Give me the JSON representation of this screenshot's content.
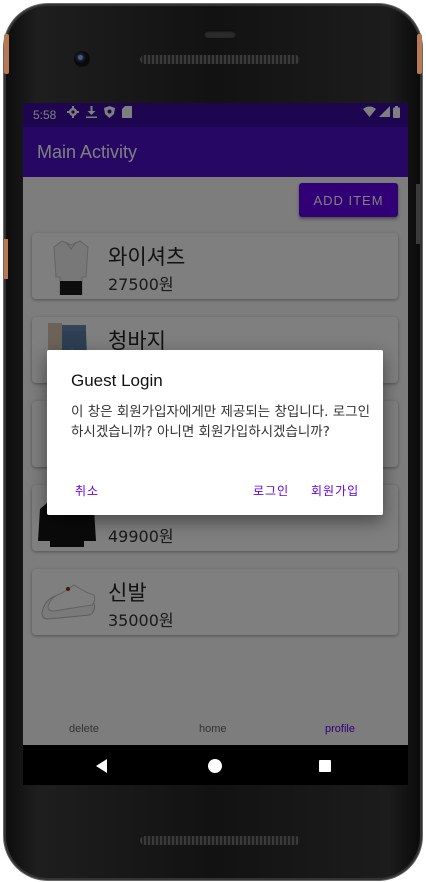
{
  "status_bar": {
    "time": "5:58",
    "left_icons": [
      "gear-icon",
      "download-icon",
      "shield-icon",
      "sd-card-icon"
    ],
    "right_icons": [
      "wifi-icon",
      "signal-icon",
      "battery-icon"
    ]
  },
  "app_bar": {
    "title": "Main Activity"
  },
  "toolbar": {
    "add_item_label": "ADD ITEM"
  },
  "items": [
    {
      "name": "와이셔츠",
      "price": "27500원",
      "image": "shirt"
    },
    {
      "name": "청바지",
      "price": "",
      "image": "jeans"
    },
    {
      "name": "",
      "price": "",
      "image": ""
    },
    {
      "name": "",
      "price": "49900원",
      "image": "sweater"
    },
    {
      "name": "신발",
      "price": "35000원",
      "image": "sneakers"
    }
  ],
  "bottom_nav": {
    "delete": "delete",
    "home": "home",
    "profile": "profile",
    "active_color": "#6200ee"
  },
  "dialog": {
    "title": "Guest Login",
    "message": "이 창은 회원가입자에게만 제공되는 창입니다. 로그인 하시겠습니까? 아니면 회원가입하시겠습니까?",
    "cancel": "취소",
    "login": "로그인",
    "signup": "회원가입"
  },
  "colors": {
    "primary": "#6200ee",
    "app_bar": "#4d0fc8",
    "status_bar": "#3a0aa0"
  }
}
